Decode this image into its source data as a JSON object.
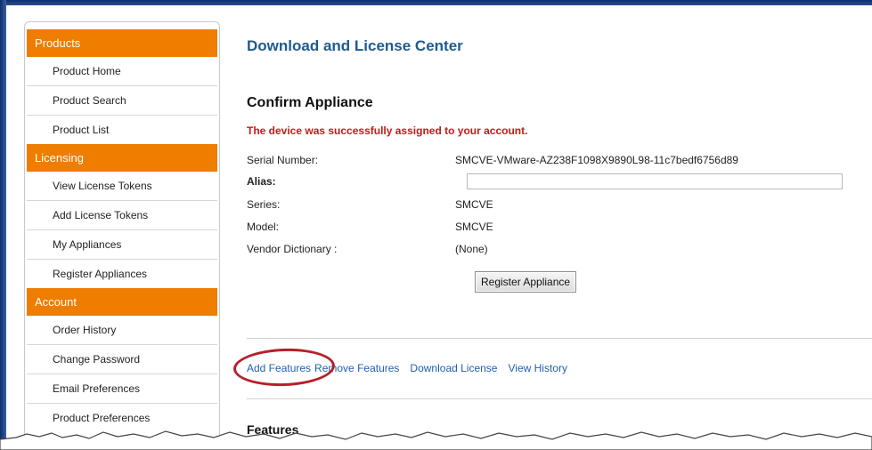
{
  "sidebar": {
    "sections": [
      {
        "title": "Products",
        "items": [
          "Product Home",
          "Product Search",
          "Product List"
        ]
      },
      {
        "title": "Licensing",
        "items": [
          "View License Tokens",
          "Add License Tokens",
          "My Appliances",
          "Register Appliances"
        ]
      },
      {
        "title": "Account",
        "items": [
          "Order History",
          "Change Password",
          "Email Preferences",
          "Product Preferences"
        ]
      }
    ]
  },
  "main": {
    "page_title": "Download and License Center",
    "section_title": "Confirm Appliance",
    "success_message": "The device was successfully assigned to your account.",
    "fields": {
      "serial_label": "Serial Number:",
      "serial_value": "SMCVE-VMware-AZ238F1098X9890L98-11c7bedf6756d89",
      "alias_label": "Alias:",
      "alias_value": "",
      "series_label": "Series:",
      "series_value": "SMCVE",
      "model_label": "Model:",
      "model_value": "SMCVE",
      "vendor_label": "Vendor Dictionary :",
      "vendor_value": "(None)"
    },
    "register_button": "Register Appliance",
    "links": {
      "add_features": "Add Features",
      "remove_features": "Remove Features",
      "download_license": "Download License",
      "view_history": "View History"
    },
    "features_title": "Features"
  },
  "colors": {
    "accent_orange": "#ee7d00",
    "title_blue": "#1f5a8f",
    "link_blue": "#1f5fb0",
    "success_red": "#d1141a",
    "annotation_red": "#b5202b"
  }
}
